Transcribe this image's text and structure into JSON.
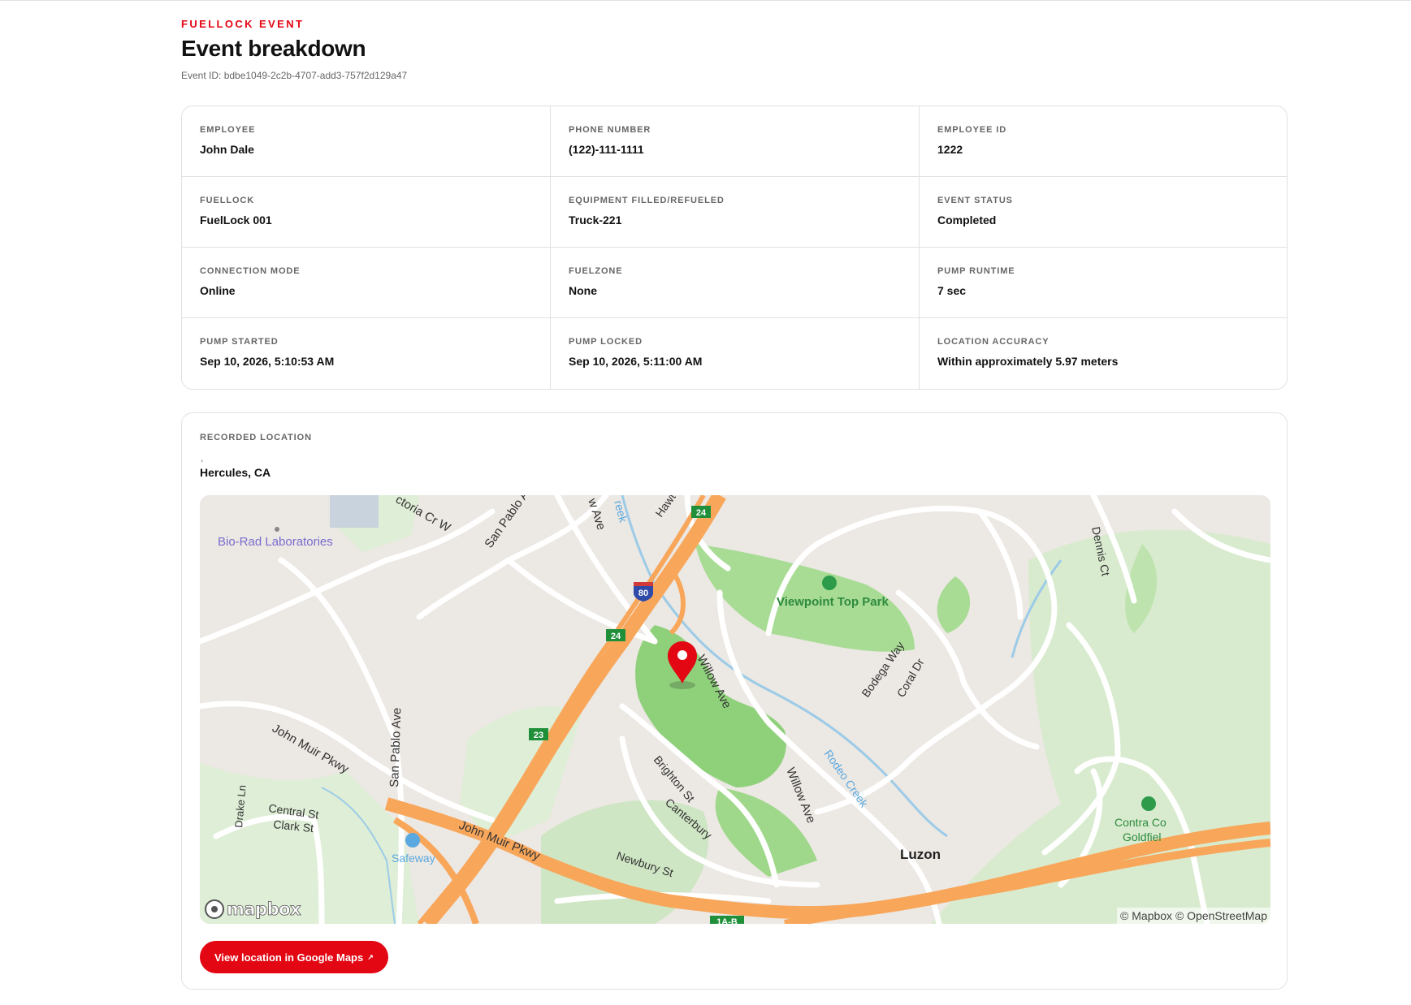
{
  "header": {
    "eyebrow": "FUELLOCK EVENT",
    "title": "Event breakdown",
    "event_id": "Event ID: bdbe1049-2c2b-4707-add3-757f2d129a47"
  },
  "details": [
    {
      "label": "EMPLOYEE",
      "value": "John Dale"
    },
    {
      "label": "PHONE NUMBER",
      "value": "(122)-111-1111"
    },
    {
      "label": "EMPLOYEE ID",
      "value": "1222"
    },
    {
      "label": "FUELLOCK",
      "value": "FuelLock 001"
    },
    {
      "label": "EQUIPMENT FILLED/REFUELED",
      "value": "Truck-221"
    },
    {
      "label": "EVENT STATUS",
      "value": "Completed"
    },
    {
      "label": "CONNECTION MODE",
      "value": "Online"
    },
    {
      "label": "FUELZONE",
      "value": "None"
    },
    {
      "label": "PUMP RUNTIME",
      "value": "7 sec"
    },
    {
      "label": "PUMP STARTED",
      "value": "Sep 10, 2026, 5:10:53 AM"
    },
    {
      "label": "PUMP LOCKED",
      "value": "Sep 10, 2026, 5:11:00 AM"
    },
    {
      "label": "LOCATION ACCURACY",
      "value": "Within approximately 5.97 meters"
    }
  ],
  "location": {
    "label": "RECORDED LOCATION",
    "address_line": ",",
    "city": "Hercules, CA",
    "map": {
      "labels": {
        "bio_rad": "Bio-Rad Laboratories",
        "viewpoint": "Viewpoint Top Park",
        "john_muir_1": "John Muir Pkwy",
        "john_muir_2": "John Muir Pkwy",
        "san_pablo_1": "San Pablo Ave",
        "san_pablo_2": "San Pablo A",
        "victoria": "ctoria Cr W",
        "willow_top": "w Ave",
        "willow_1": "Willow Ave",
        "willow_2": "Willow Ave",
        "creek_top": "reek",
        "hawt": "Hawt",
        "dennis": "Dennis Ct",
        "bodega": "Bodega Way",
        "coral": "Coral Dr",
        "rodeo": "Rodeo Creek",
        "brighton": "Brighton St",
        "canterbury": "Canterbury",
        "newbury": "Newbury St",
        "central": "Central St",
        "clark": "Clark St",
        "drake": "Drake Ln",
        "safeway": "Safeway",
        "luzon": "Luzon",
        "contra_1": "Contra Co",
        "contra_2": "Goldfiel",
        "hwy_24a": "24",
        "hwy_24b": "24",
        "hwy_23": "23",
        "hwy_80": "80",
        "hwy_1ab": "1A-B"
      },
      "logo": "mapbox",
      "attribution": "© Mapbox © OpenStreetMap",
      "colors": {
        "land": "#ece8e3",
        "park": "#cfe6c4",
        "park_dark": "#8fd17b",
        "highway": "#f8a65a",
        "water": "#9ccbe8",
        "pin": "#e30613"
      }
    },
    "button_label": "View location in Google Maps",
    "button_icon": "external-link-icon",
    "button_glyph": "↗"
  },
  "colors": {
    "accent": "#e30613",
    "border": "#e1e1e1",
    "muted": "#666666"
  }
}
